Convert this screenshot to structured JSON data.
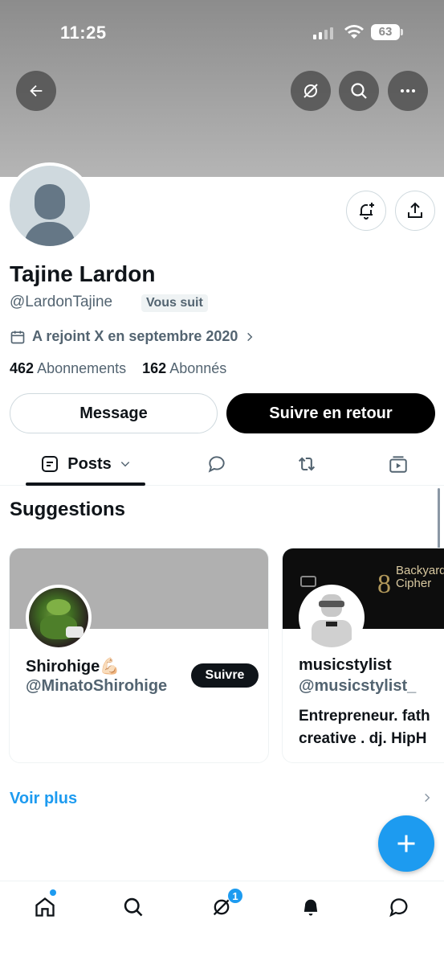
{
  "status_bar": {
    "time": "11:25",
    "battery": "63"
  },
  "profile": {
    "name": "Tajine Lardon",
    "handle": "@LardonTajine",
    "follows_you": "Vous suit",
    "joined": "A rejoint X en septembre 2020",
    "following_count": "462",
    "following_label": "Abonnements",
    "followers_count": "162",
    "followers_label": "Abonnés"
  },
  "actions": {
    "message": "Message",
    "follow_back": "Suivre en retour"
  },
  "tabs": [
    {
      "label": "Posts",
      "active": true
    }
  ],
  "suggestions": {
    "title": "Suggestions",
    "cards": [
      {
        "name": "Shirohige💪🏻",
        "handle": "@MinatoShirohige",
        "follow": "Suivre",
        "bio": ""
      },
      {
        "name": "musicstylist",
        "handle": "@musicstylist_",
        "bio_line1": "Entrepreneur. fath",
        "bio_line2": "creative . dj. HipH",
        "banner_text_big": "8",
        "banner_text1": "Backyard",
        "banner_text2": "Cipher"
      }
    ],
    "see_more": "Voir plus"
  },
  "nav": {
    "messages_badge": "1"
  },
  "colors": {
    "accent": "#1d9bf0",
    "text": "#0f1419",
    "muted": "#536471"
  }
}
